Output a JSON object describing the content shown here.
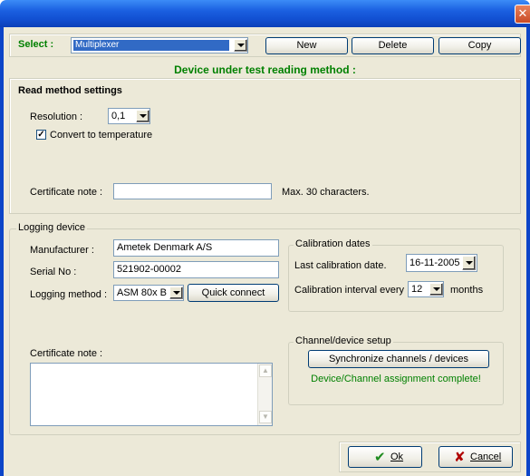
{
  "window": {
    "close_glyph": "✕"
  },
  "toolbar": {
    "select_label": "Select :",
    "select_value": "Multiplexer",
    "new_label": "New",
    "delete_label": "Delete",
    "copy_label": "Copy"
  },
  "heading": "Device under test reading method :",
  "read_method": {
    "title": "Read method settings",
    "resolution_label": "Resolution :",
    "resolution_value": "0,1",
    "convert_checked": true,
    "convert_label": "Convert to temperature",
    "cert_note_label": "Certificate note :",
    "cert_note_value": "",
    "max_chars_label": "Max. 30 characters."
  },
  "logging": {
    "title": "Logging device",
    "manufacturer_label": "Manufacturer :",
    "manufacturer_value": "Ametek Denmark A/S",
    "serial_label": "Serial No :",
    "serial_value": "521902-00002",
    "method_label": "Logging method :",
    "method_value": "ASM 80x B",
    "quick_connect_label": "Quick connect",
    "cert_note_label": "Certificate note :",
    "cert_note_value": ""
  },
  "calibration": {
    "title": "Calibration dates",
    "last_label": "Last calibration date.",
    "last_value": "16-11-2005",
    "interval_label": "Calibration interval every :",
    "interval_value": "12",
    "months_label": "months"
  },
  "channel": {
    "title": "Channel/device setup",
    "sync_label": "Synchronize channels / devices",
    "status": "Device/Channel assignment complete!"
  },
  "footer": {
    "ok_label": "Ok",
    "cancel_label": "Cancel"
  },
  "colors": {
    "heading_green": "#008000",
    "status_green": "#008000",
    "select_highlight": "#316ac5",
    "ok_check": "#1e8a1e",
    "cancel_x": "#b00000"
  }
}
